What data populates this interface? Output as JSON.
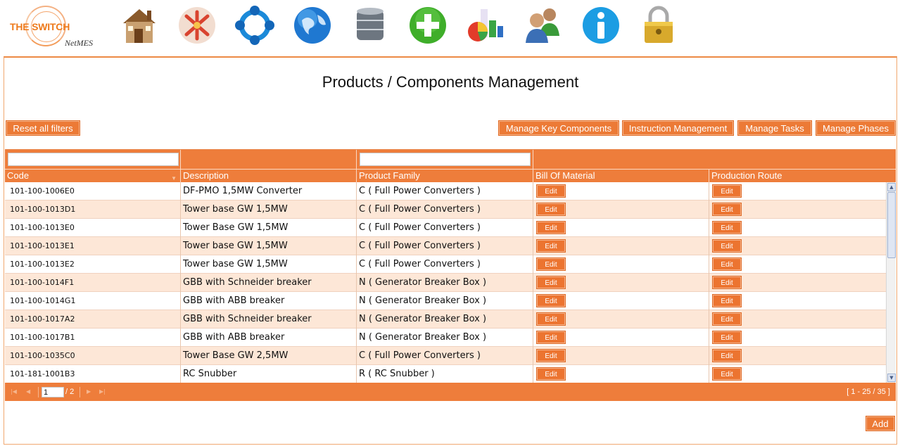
{
  "logo": {
    "title": "THE SWITCH",
    "subtitle": "NetMES"
  },
  "nav": [
    {
      "name": "home-icon",
      "label": "home"
    },
    {
      "name": "tools-icon",
      "label": "tools"
    },
    {
      "name": "process-cycle-icon",
      "label": "process"
    },
    {
      "name": "globe-icon",
      "label": "globe"
    },
    {
      "name": "database-icon",
      "label": "database"
    },
    {
      "name": "add-icon",
      "label": "add"
    },
    {
      "name": "chart-icon",
      "label": "chart"
    },
    {
      "name": "users-icon",
      "label": "users"
    },
    {
      "name": "info-icon",
      "label": "info"
    },
    {
      "name": "lock-icon",
      "label": "lock"
    }
  ],
  "page": {
    "title": "Products / Components Management"
  },
  "buttons": {
    "reset_filters": "Reset all filters",
    "manage_key_components": "Manage Key Components",
    "instruction_management": "Instruction Management",
    "manage_tasks": "Manage Tasks",
    "manage_phases": "Manage Phases",
    "add": "Add"
  },
  "grid": {
    "columns": [
      "Code",
      "Description",
      "Product Family",
      "Bill Of Material",
      "Production Route"
    ],
    "edit_label": "Edit",
    "rows": [
      {
        "code": "101-100-1006E0",
        "description": "DF-PMO 1,5MW Converter",
        "family": "C ( Full Power Converters )"
      },
      {
        "code": "101-100-1013D1",
        "description": "Tower base GW 1,5MW",
        "family": "C ( Full Power Converters )"
      },
      {
        "code": "101-100-1013E0",
        "description": "Tower Base GW 1,5MW",
        "family": "C ( Full Power Converters )"
      },
      {
        "code": "101-100-1013E1",
        "description": "Tower base GW 1,5MW",
        "family": "C ( Full Power Converters )"
      },
      {
        "code": "101-100-1013E2",
        "description": "Tower base GW 1,5MW",
        "family": "C ( Full Power Converters )"
      },
      {
        "code": "101-100-1014F1",
        "description": "GBB with Schneider breaker",
        "family": "N ( Generator Breaker Box )"
      },
      {
        "code": "101-100-1014G1",
        "description": "GBB with ABB breaker",
        "family": "N ( Generator Breaker Box )"
      },
      {
        "code": "101-100-1017A2",
        "description": "GBB with Schneider breaker",
        "family": "N ( Generator Breaker Box )"
      },
      {
        "code": "101-100-1017B1",
        "description": "GBB with ABB breaker",
        "family": "N ( Generator Breaker Box )"
      },
      {
        "code": "101-100-1035C0",
        "description": "Tower Base GW 2,5MW",
        "family": "C ( Full Power Converters )"
      },
      {
        "code": "101-181-1001B3",
        "description": "RC Snubber",
        "family": "R ( RC Snubber )"
      }
    ]
  },
  "pager": {
    "current_page": "1",
    "total_pages": "/ 2",
    "range": "[ 1 - 25 / 35 ]"
  },
  "colors": {
    "accent": "#ee7d3b",
    "row_alt": "#fde7d7"
  }
}
